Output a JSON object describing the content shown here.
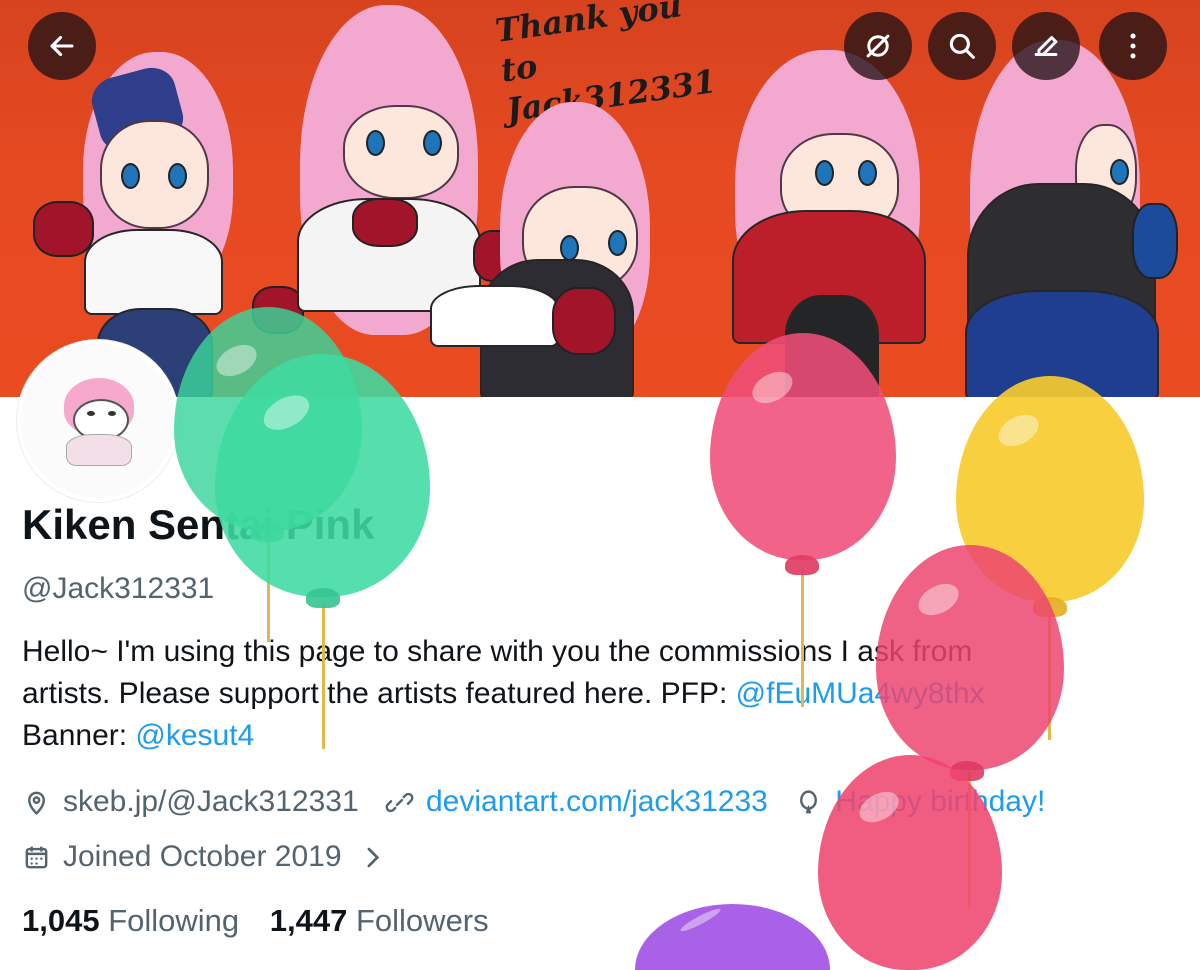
{
  "header": {
    "banner_text_line1": "Thank you",
    "banner_text_line2": "to Jack312331"
  },
  "top_actions": {
    "back": "arrow-left-icon",
    "hide": "eye-slash-icon",
    "search": "search-icon",
    "edit": "pencil-icon",
    "more": "more-vertical-icon"
  },
  "profile": {
    "name": "Kiken Sentai Pink",
    "handle": "@Jack312331",
    "bio_line1": "Hello~ I'm using this page to share with you the commissions I ask from",
    "bio_line2_prefix": "artists. Please support the artists featured here.  PFP: ",
    "bio_link_pfp": "@fEuMUa4wy8thx",
    "bio_line3_prefix": "Banner: ",
    "bio_link_banner": "@kesut4",
    "location": "skeb.jp/@Jack312331",
    "website": "deviantart.com/jack31233",
    "birthday": "Happy birthday!",
    "joined": "Joined October 2019",
    "following_count": "1,045",
    "following_label": "Following",
    "followers_count": "1,447",
    "followers_label": "Followers"
  },
  "colors": {
    "banner": "#e64a22",
    "link": "#1d9bf0",
    "balloon_green": "#39d69b",
    "balloon_pink": "#ef4d78",
    "balloon_yellow": "#f6cb2f",
    "balloon_purple": "#a55be6"
  }
}
